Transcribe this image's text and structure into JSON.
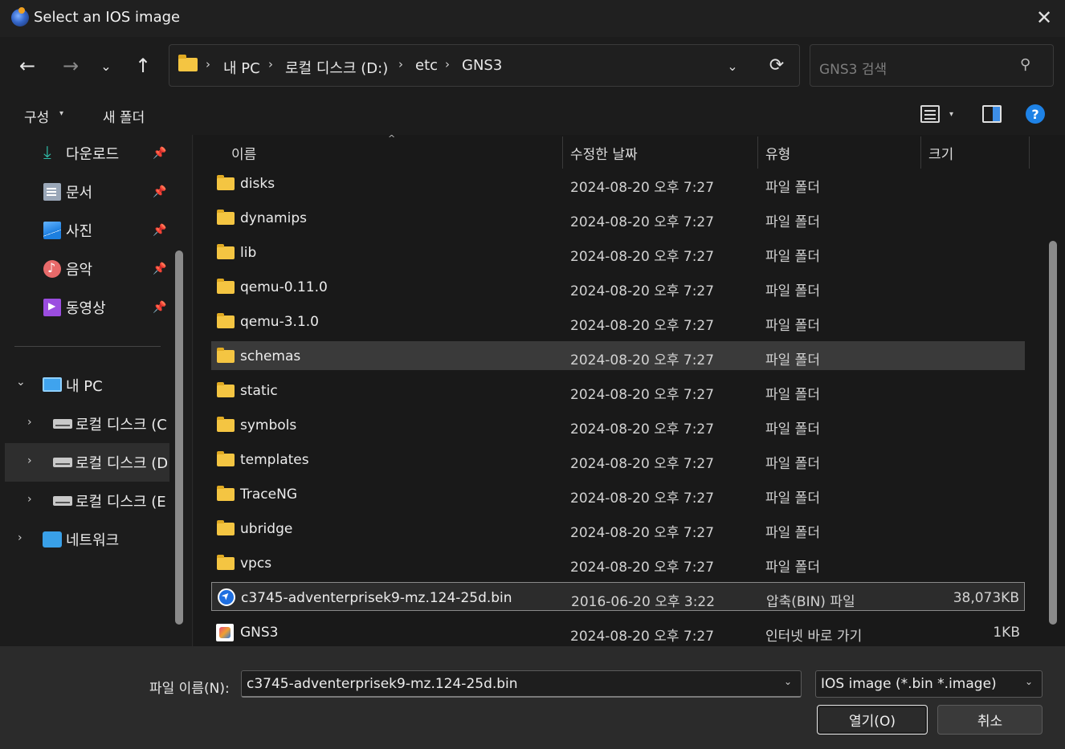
{
  "window": {
    "title": "Select an IOS image",
    "close_glyph": "✕"
  },
  "nav": {
    "back_glyph": "←",
    "forward_glyph": "→",
    "recent_glyph": "⌄",
    "up_glyph": "↑",
    "breadcrumb": [
      "내 PC",
      "로컬 디스크 (D:)",
      "etc",
      "GNS3"
    ],
    "sep_glyph": "›",
    "dropdown_glyph": "⌄",
    "refresh_glyph": "⟳",
    "search_placeholder": "GNS3 검색",
    "search_glyph": "⚲"
  },
  "toolbar": {
    "organize_label": "구성",
    "organize_caret": "▾",
    "new_folder_label": "새 폴더",
    "view_caret": "▾",
    "help_glyph": "?"
  },
  "sidebar": {
    "pin_glyph": "📌",
    "quick": [
      {
        "label": "다운로드",
        "icon": "download-icon"
      },
      {
        "label": "문서",
        "icon": "document-icon"
      },
      {
        "label": "사진",
        "icon": "pictures-icon"
      },
      {
        "label": "음악",
        "icon": "music-icon"
      },
      {
        "label": "동영상",
        "icon": "video-icon"
      }
    ],
    "this_pc": "내 PC",
    "drives": [
      "로컬 디스크 (C",
      "로컬 디스크 (D",
      "로컬 디스크 (E"
    ],
    "network": "네트워크",
    "chev_open": "⌄",
    "chev_closed": "›"
  },
  "columns": {
    "name": "이름",
    "modified": "수정한 날짜",
    "type": "유형",
    "size": "크기",
    "sort_glyph": "^"
  },
  "files": [
    {
      "name": "disks",
      "date": "2024-08-20 오후 7:27",
      "type": "파일 폴더",
      "size": ""
    },
    {
      "name": "dynamips",
      "date": "2024-08-20 오후 7:27",
      "type": "파일 폴더",
      "size": ""
    },
    {
      "name": "lib",
      "date": "2024-08-20 오후 7:27",
      "type": "파일 폴더",
      "size": ""
    },
    {
      "name": "qemu-0.11.0",
      "date": "2024-08-20 오후 7:27",
      "type": "파일 폴더",
      "size": ""
    },
    {
      "name": "qemu-3.1.0",
      "date": "2024-08-20 오후 7:27",
      "type": "파일 폴더",
      "size": ""
    },
    {
      "name": "schemas",
      "date": "2024-08-20 오후 7:27",
      "type": "파일 폴더",
      "size": ""
    },
    {
      "name": "static",
      "date": "2024-08-20 오후 7:27",
      "type": "파일 폴더",
      "size": ""
    },
    {
      "name": "symbols",
      "date": "2024-08-20 오후 7:27",
      "type": "파일 폴더",
      "size": ""
    },
    {
      "name": "templates",
      "date": "2024-08-20 오후 7:27",
      "type": "파일 폴더",
      "size": ""
    },
    {
      "name": "TraceNG",
      "date": "2024-08-20 오후 7:27",
      "type": "파일 폴더",
      "size": ""
    },
    {
      "name": "ubridge",
      "date": "2024-08-20 오후 7:27",
      "type": "파일 폴더",
      "size": ""
    },
    {
      "name": "vpcs",
      "date": "2024-08-20 오후 7:27",
      "type": "파일 폴더",
      "size": ""
    },
    {
      "name": "c3745-adventerprisek9-mz.124-25d.bin",
      "date": "2016-06-20 오후 3:22",
      "type": "압축(BIN) 파일",
      "size": "38,073KB"
    },
    {
      "name": "GNS3",
      "date": "2024-08-20 오후 7:27",
      "type": "인터넷 바로 가기",
      "size": "1KB"
    }
  ],
  "footer": {
    "filename_label": "파일 이름(N):",
    "filename_value": "c3745-adventerprisek9-mz.124-25d.bin",
    "filetype_value": "IOS image (*.bin *.image)",
    "caret_glyph": "⌄",
    "open_label": "열기(O)",
    "cancel_label": "취소"
  }
}
